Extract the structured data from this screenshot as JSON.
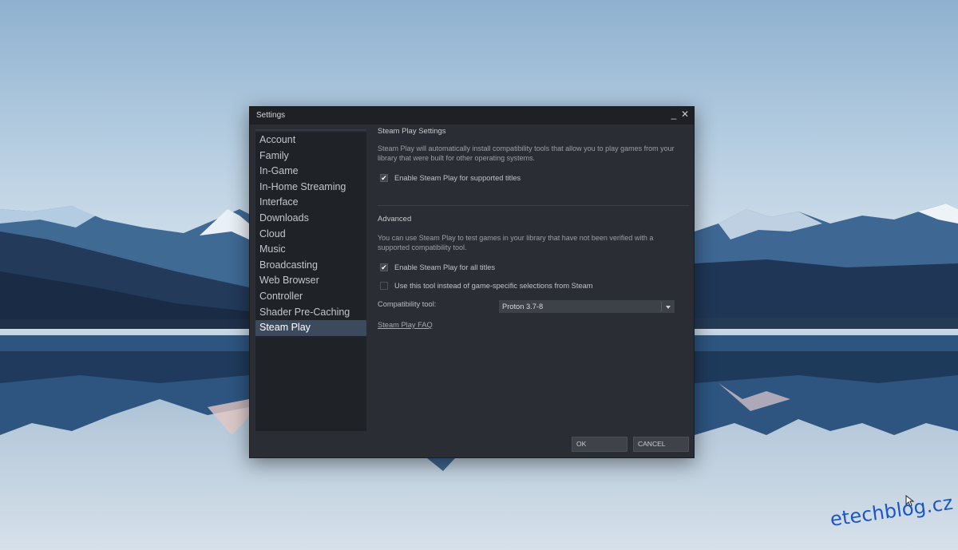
{
  "window": {
    "title": "Settings"
  },
  "titlebar": {
    "minimize_glyph": "_",
    "close_glyph": "✕"
  },
  "sidebar": {
    "items": [
      {
        "label": "Account"
      },
      {
        "label": "Family"
      },
      {
        "label": "In-Game"
      },
      {
        "label": "In-Home Streaming"
      },
      {
        "label": "Interface"
      },
      {
        "label": "Downloads"
      },
      {
        "label": "Cloud"
      },
      {
        "label": "Music"
      },
      {
        "label": "Broadcasting"
      },
      {
        "label": "Web Browser"
      },
      {
        "label": "Controller"
      },
      {
        "label": "Shader Pre-Caching"
      },
      {
        "label": "Steam Play"
      }
    ],
    "active": "Steam Play"
  },
  "content": {
    "section_title": "Steam Play Settings",
    "description": "Steam Play will automatically install compatibility tools that allow you to play games from your library that were built for other operating systems.",
    "enable_supported": {
      "label": "Enable Steam Play for supported titles",
      "checked": true
    },
    "advanced_title": "Advanced",
    "advanced_description": "You can use Steam Play to test games in your library that have not been verified with a supported compatibility tool.",
    "enable_all": {
      "label": "Enable Steam Play for all titles",
      "checked": true
    },
    "use_tool": {
      "label": "Use this tool instead of game-specific selections from Steam",
      "checked": false
    },
    "compat_label": "Compatibility tool:",
    "compat_value": "Proton 3.7-8",
    "faq_link": "Steam Play FAQ"
  },
  "footer": {
    "ok_label": "OK",
    "cancel_label": "CANCEL"
  },
  "watermark": "etechblog.cz",
  "colors": {
    "accent_selection": "#3d4a5e",
    "window_bg": "#2a2d33",
    "watermark": "#1a55c8"
  }
}
